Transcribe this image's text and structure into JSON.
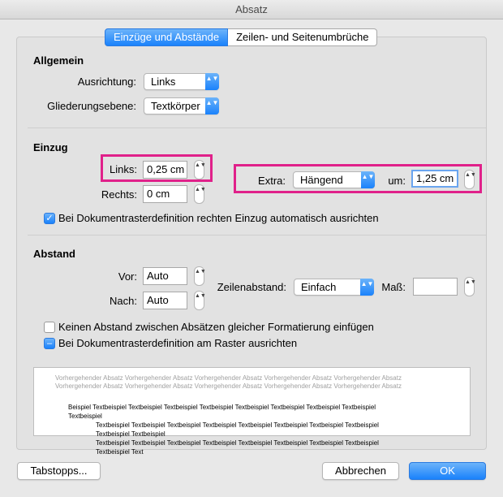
{
  "window": {
    "title": "Absatz"
  },
  "tabs": [
    {
      "label": "Einzüge und Abstände"
    },
    {
      "label": "Zeilen- und Seitenumbrüche"
    }
  ],
  "allgemein": {
    "heading": "Allgemein",
    "ausrichtung_label": "Ausrichtung:",
    "ausrichtung_value": "Links",
    "gliederung_label": "Gliederungsebene:",
    "gliederung_value": "Textkörper"
  },
  "einzug": {
    "heading": "Einzug",
    "links_label": "Links:",
    "links_value": "0,25 cm",
    "rechts_label": "Rechts:",
    "rechts_value": "0 cm",
    "extra_label": "Extra:",
    "extra_value": "Hängend",
    "um_label": "um:",
    "um_value": "1,25 cm",
    "auto_checkbox_label": "Bei Dokumentrasterdefinition rechten Einzug automatisch ausrichten"
  },
  "abstand": {
    "heading": "Abstand",
    "vor_label": "Vor:",
    "vor_value": "Auto",
    "nach_label": "Nach:",
    "nach_value": "Auto",
    "zeilenabstand_label": "Zeilenabstand:",
    "zeilenabstand_value": "Einfach",
    "mass_label": "Maß:",
    "mass_value": "",
    "no_space_label": "Keinen Abstand zwischen Absätzen gleicher Formatierung einfügen",
    "grid_label": "Bei Dokumentrasterdefinition am Raster ausrichten"
  },
  "preview": {
    "previous_text": "Vorhergehender Absatz Vorhergehender Absatz Vorhergehender Absatz Vorhergehender Absatz Vorhergehender Absatz Vorhergehender Absatz Vorhergehender Absatz Vorhergehender Absatz Vorhergehender Absatz Vorhergehender Absatz",
    "sample_line1": "Beispiel Textbeispiel Textbeispiel Textbeispiel Textbeispiel Textbeispiel Textbeispiel Textbeispiel Textbeispiel Textbeispiel",
    "sample_line2": "Textbeispiel Textbeispiel Textbeispiel Textbeispiel Textbeispiel Textbeispiel Textbeispiel Textbeispiel Textbeispiel Textbeispiel",
    "sample_line3": "Textbeispiel Textbeispiel Textbeispiel Textbeispiel Textbeispiel Textbeispiel Textbeispiel Textbeispiel Textbeispiel Text"
  },
  "buttons": {
    "tabstopps": "Tabstopps...",
    "abbrechen": "Abbrechen",
    "ok": "OK"
  },
  "icons": {
    "popup_arrows": "▲▼",
    "stepper_arrows": "▲▼",
    "checkmark": "✓",
    "mixed": "–"
  },
  "colors": {
    "accent": "#1a82fb",
    "highlight": "#e0218a"
  }
}
